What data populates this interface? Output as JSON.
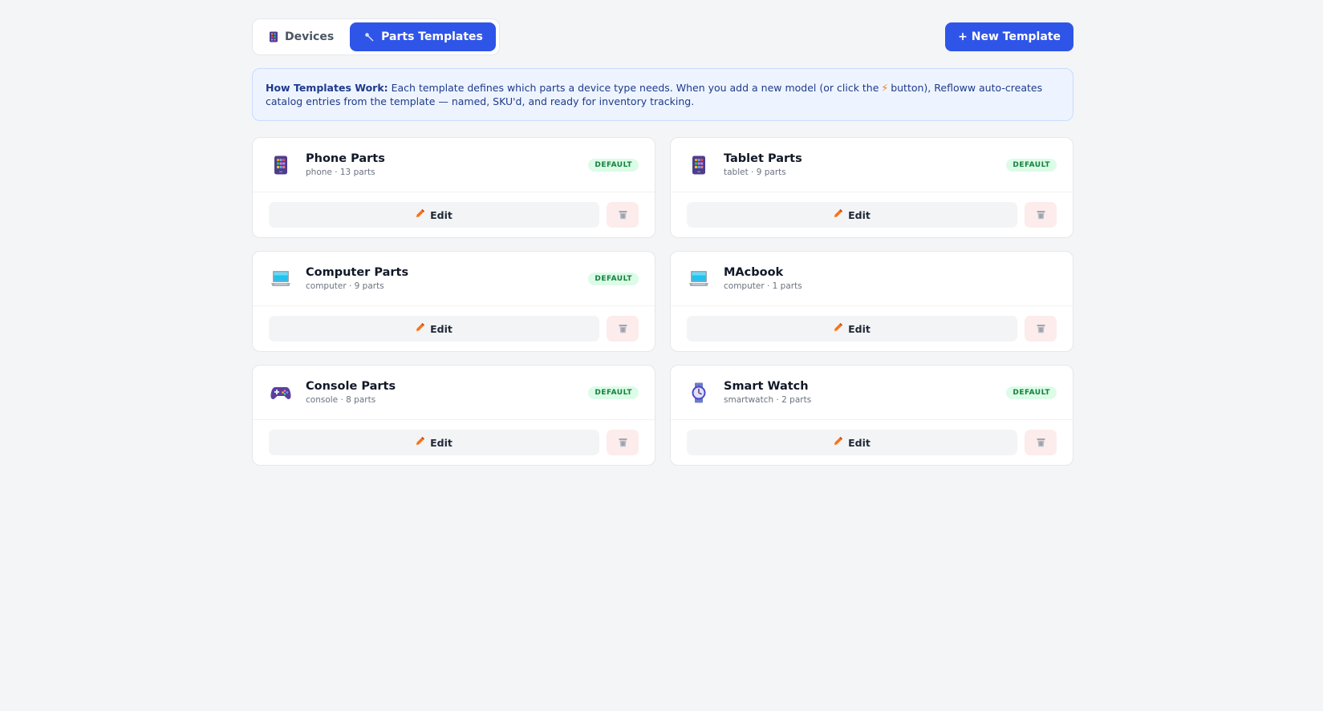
{
  "tabs": [
    {
      "label": "Devices",
      "icon": "tablet-icon",
      "active": false
    },
    {
      "label": "Parts Templates",
      "icon": "wrench-icon",
      "active": true
    }
  ],
  "new_template_label": "+ New Template",
  "info": {
    "heading": "How Templates Work:",
    "text_before": "Each template defines which parts a device type needs. When you add a new model (or click the",
    "text_after": "button), Refloww auto-creates catalog entries from the template — named, SKU'd, and ready for inventory tracking."
  },
  "edit_label": "Edit",
  "default_badge": "DEFAULT",
  "templates": [
    {
      "name": "Phone Parts",
      "subtitle": "phone · 13 parts",
      "icon": "tablet-icon",
      "default": true
    },
    {
      "name": "Tablet Parts",
      "subtitle": "tablet · 9 parts",
      "icon": "tablet-icon",
      "default": true
    },
    {
      "name": "Computer Parts",
      "subtitle": "computer · 9 parts",
      "icon": "laptop-icon",
      "default": true
    },
    {
      "name": "MAcbook",
      "subtitle": "computer · 1 parts",
      "icon": "laptop-icon",
      "default": false
    },
    {
      "name": "Console Parts",
      "subtitle": "console · 8 parts",
      "icon": "gamepad-icon",
      "default": true
    },
    {
      "name": "Smart Watch",
      "subtitle": "smartwatch · 2 parts",
      "icon": "watch-icon",
      "default": true
    }
  ],
  "colors": {
    "primary": "#2f55e8",
    "badge_bg": "#dcfce7",
    "badge_text": "#15803d",
    "accent": "#f97316"
  }
}
